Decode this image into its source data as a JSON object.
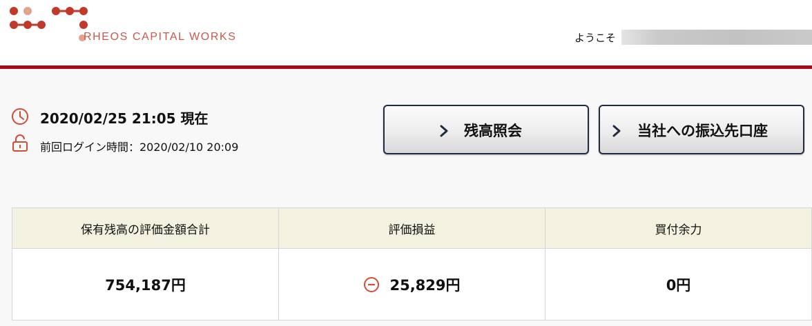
{
  "header": {
    "logo_text": "RHEOS CAPITAL WORKS",
    "welcome": "ようこそ",
    "brand_color": "#a50c14",
    "logo_dot_colors": [
      "#c0392b",
      "#e1a38c"
    ]
  },
  "status": {
    "current_datetime": "2020/02/25 21:05 現在",
    "last_login": "前回ログイン時間：2020/02/10 20:09",
    "icons": [
      "clock-icon",
      "unlock-icon"
    ]
  },
  "actions": {
    "balance_label": "残高照会",
    "transfer_label": "当社への振込先口座",
    "chevron_icon": "chevron-right-icon"
  },
  "summary": {
    "headers": [
      "保有残高の評価金額合計",
      "評価損益",
      "買付余力"
    ],
    "values": [
      "754,187円",
      "25,829円",
      "0円"
    ],
    "pl_sign_icon": "minus-circle-icon",
    "header_bg": "#f3f1df",
    "negative_color": "#d24b35"
  }
}
